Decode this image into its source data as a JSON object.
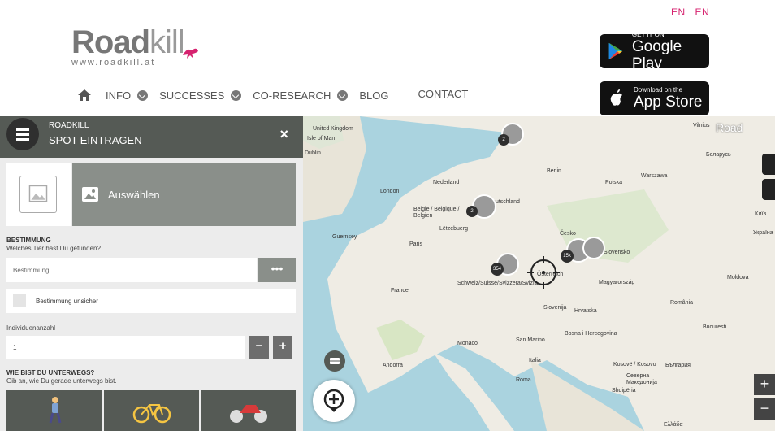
{
  "lang": [
    "EN",
    "EN"
  ],
  "logo": {
    "word_bold": "Road",
    "word_thin": "kill",
    "url": "www.roadkill.at"
  },
  "stores": [
    {
      "small": "GET IT ON",
      "big": "Google Play"
    },
    {
      "small": "Download on the",
      "big": "App Store"
    }
  ],
  "nav": {
    "items": [
      "INFO",
      "SUCCESSES",
      "CO-RESEARCH",
      "BLOG",
      "CONTACT"
    ]
  },
  "panel": {
    "app_name": "ROADKILL",
    "title": "SPOT EINTRAGEN",
    "close": "×",
    "select_label": "Auswählen",
    "id_heading": "BESTIMMUNG",
    "id_question": "Welches Tier hast Du gefunden?",
    "id_placeholder": "Bestimmung",
    "dots": "•••",
    "uncertain_label": "Bestimmung unsicher",
    "count_label": "Individuenanzahl",
    "count_value": "1",
    "minus": "−",
    "plus": "+",
    "travel_heading": "WIE BIST DU UNTERWEGS?",
    "travel_hint": "Gib an, wie Du gerade unterwegs bist."
  },
  "map": {
    "labels": [
      "United Kingdom",
      "Isle of Man",
      "Dublin",
      "London",
      "Nederland",
      "België / Belgique / Belgien",
      "Lëtzebuerg",
      "Deutschland",
      "Berlin",
      "Polska",
      "Warszawa",
      "Беларусь",
      "Guernsey",
      "Paris",
      "France",
      "Česko",
      "Slovensko",
      "Україна",
      "Schweiz/Suisse/Svizzera/Svizra",
      "Österreich",
      "Magyarország",
      "Moldova",
      "Slovenija",
      "Hrvatska",
      "România",
      "Bucuresti",
      "Bosna i Hercegovina",
      "Monaco",
      "San Marino",
      "Italia",
      "Andorra",
      "Roma",
      "Kosovë / Kosovo",
      "България",
      "Северна Македонија",
      "Shqipëria",
      "Ελλάδα",
      "Kиїв",
      "Vilnius",
      "Road"
    ],
    "clusters": [
      "2",
      "2",
      "354",
      "15k"
    ],
    "zoom_in": "+",
    "zoom_out": "−"
  },
  "colors": {
    "accent": "#d6226f",
    "panel_dark": "#555a55",
    "button_grey": "#8a8f8a"
  }
}
